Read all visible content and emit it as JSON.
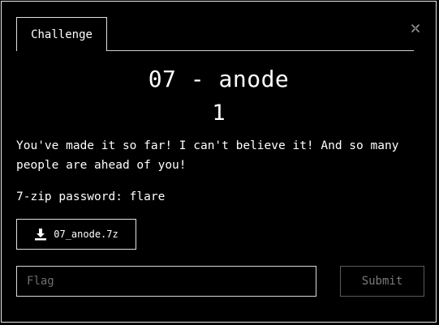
{
  "tabs": [
    {
      "label": "Challenge"
    }
  ],
  "challenge": {
    "name": "07 - anode",
    "value": "1",
    "description": "You've made it so far! I can't believe it! And so many people are ahead of you!",
    "password_line": "7-zip password: flare"
  },
  "download": {
    "icon": "download-icon",
    "filename": "07_anode.7z"
  },
  "form": {
    "flag_placeholder": "Flag",
    "flag_value": "",
    "submit_label": "Submit"
  },
  "icons": {
    "close": "close-icon"
  },
  "colors": {
    "background": "#000000",
    "foreground": "#ffffff",
    "border": "#e0e0e0",
    "muted": "#7a7a7a"
  }
}
